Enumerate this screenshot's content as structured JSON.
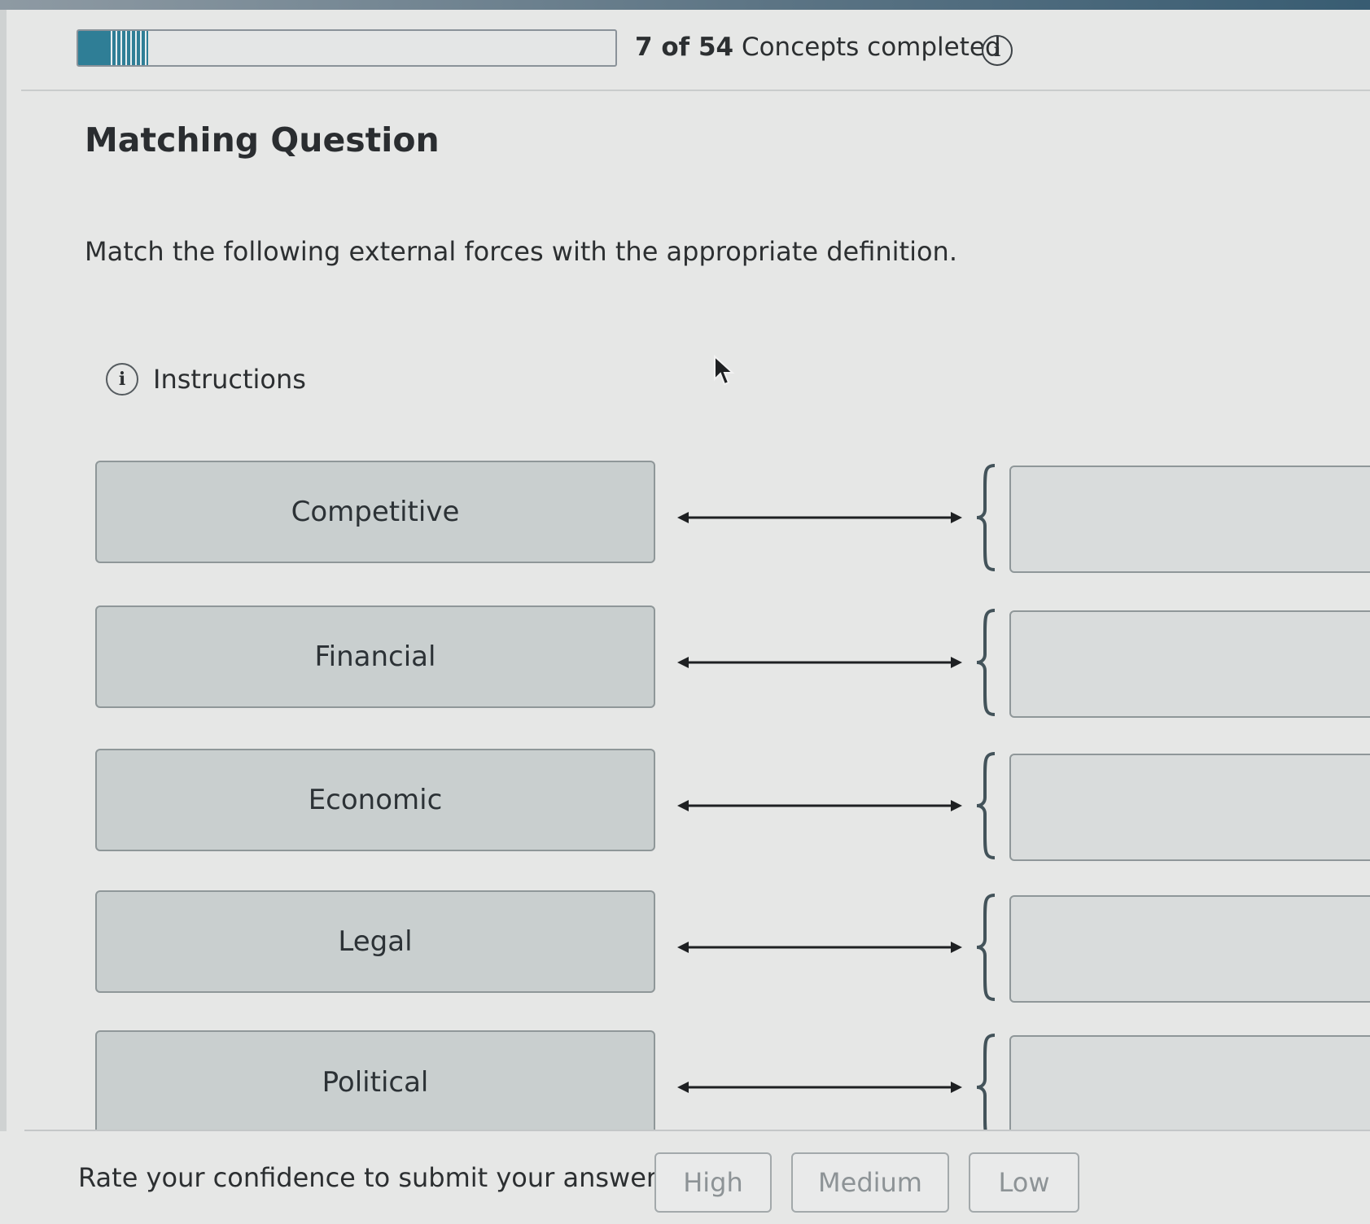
{
  "progress": {
    "completed": "7 of 54",
    "suffix": " Concepts completed",
    "fraction": 0.13
  },
  "page_title": "Matching Question",
  "prompt": "Match the following external forces with the appropriate definition.",
  "instructions_label": "Instructions",
  "terms": [
    {
      "label": "Competitive"
    },
    {
      "label": "Financial"
    },
    {
      "label": "Economic"
    },
    {
      "label": "Legal"
    },
    {
      "label": "Political"
    }
  ],
  "confidence": {
    "label": "Rate your confidence to submit your answer.",
    "high": "High",
    "medium": "Medium",
    "low": "Low"
  },
  "colors": {
    "accent": "#2f7e96",
    "term_bg": "#c9cfcf",
    "page_bg": "#e6e7e6"
  }
}
